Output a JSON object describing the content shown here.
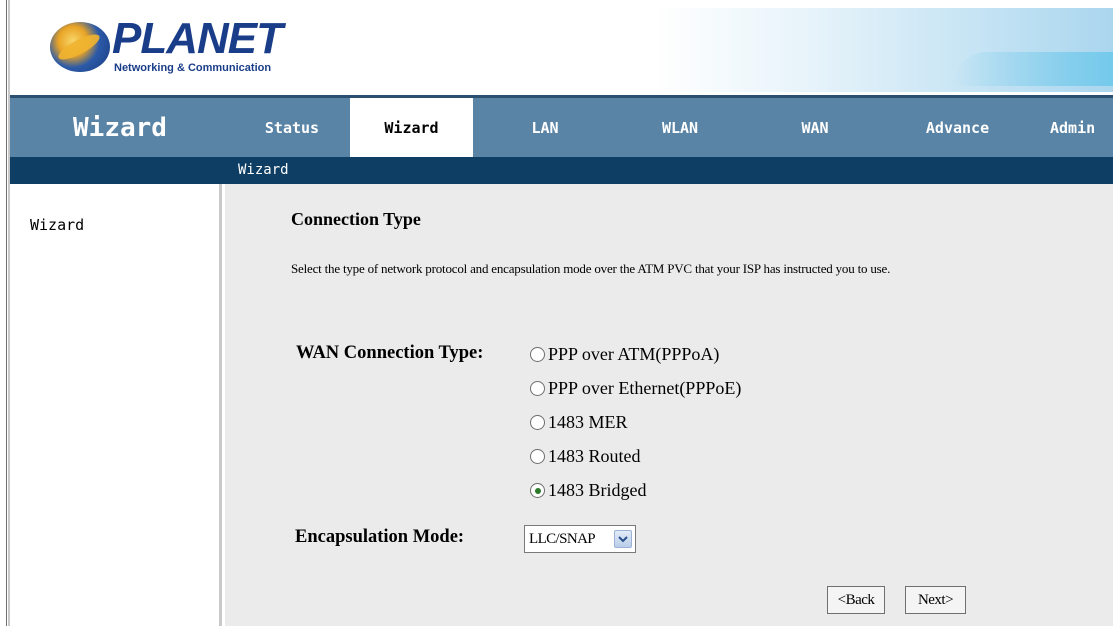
{
  "header": {
    "brand_name": "PLANET",
    "brand_tagline": "Networking & Communication"
  },
  "nav": {
    "section_title": "Wizard",
    "tabs": [
      {
        "label": "Status"
      },
      {
        "label": "Wizard",
        "active": true
      },
      {
        "label": "LAN"
      },
      {
        "label": "WLAN"
      },
      {
        "label": "WAN"
      },
      {
        "label": "Advance"
      },
      {
        "label": "Admin"
      }
    ],
    "subnav": [
      "Wizard"
    ]
  },
  "sidebar": {
    "items": [
      {
        "label": "Wizard"
      }
    ]
  },
  "main": {
    "title": "Connection Type",
    "description": "Select the type of network protocol and encapsulation mode over the ATM PVC that your ISP has instructed you to use.",
    "wan_label": "WAN Connection Type:",
    "wan_options": [
      {
        "label": "PPP over ATM(PPPoA)",
        "selected": false
      },
      {
        "label": "PPP over Ethernet(PPPoE)",
        "selected": false
      },
      {
        "label": "1483 MER",
        "selected": false
      },
      {
        "label": "1483 Routed",
        "selected": false
      },
      {
        "label": "1483 Bridged",
        "selected": true
      }
    ],
    "encap_label": "Encapsulation Mode:",
    "encap_value": "LLC/SNAP",
    "back_label": "<Back",
    "next_label": "Next>"
  },
  "colors": {
    "nav_bar": "#5a84a6",
    "subnav_bar": "#0e3e64",
    "content_bg": "#ebebeb",
    "brand_blue": "#1a3d8a"
  },
  "icons": {
    "logo": "planet-globe-logo",
    "dropdown": "chevron-down-icon"
  }
}
